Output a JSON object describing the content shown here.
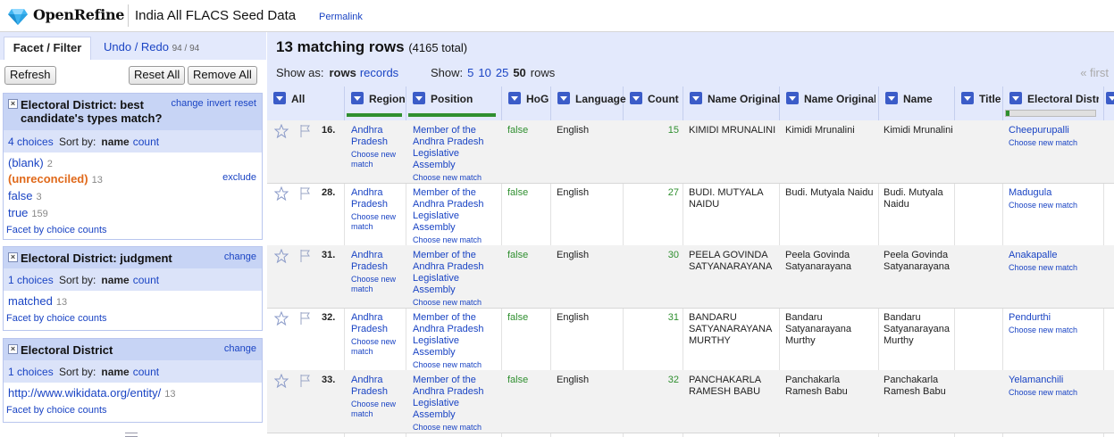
{
  "header": {
    "app_name": "OpenRefine",
    "project_name": "India All FLACS Seed Data",
    "permalink": "Permalink"
  },
  "left_panel": {
    "tabs": [
      {
        "label": "Facet / Filter"
      },
      {
        "label": "Undo / Redo",
        "count": "94 / 94"
      }
    ],
    "buttons": {
      "refresh": "Refresh",
      "reset_all": "Reset All",
      "remove_all": "Remove All"
    },
    "facets": [
      {
        "title_line1": "Electoral District: best",
        "title_line2": "candidate's types match?",
        "actions": [
          "change",
          "invert",
          "reset"
        ],
        "choices_count": "4 choices",
        "sort_by": "Sort by:",
        "sort_name": "name",
        "sort_count": "count",
        "choices": [
          {
            "label": "(blank)",
            "count": "2"
          },
          {
            "label": "(unreconciled)",
            "count": "13"
          },
          {
            "label": "false",
            "count": "3"
          },
          {
            "label": "true",
            "count": "159"
          }
        ],
        "exclude": "exclude",
        "facet_by_counts": "Facet by choice counts"
      },
      {
        "title_line1": "Electoral District: judgment",
        "actions": [
          "change"
        ],
        "choices_count": "1 choices",
        "sort_by": "Sort by:",
        "sort_name": "name",
        "sort_count": "count",
        "choices": [
          {
            "label": "matched",
            "count": "13"
          }
        ],
        "facet_by_counts": "Facet by choice counts"
      },
      {
        "title_line1": "Electoral District",
        "actions": [
          "change"
        ],
        "choices_count": "1 choices",
        "sort_by": "Sort by:",
        "sort_name": "name",
        "sort_count": "count",
        "choices": [
          {
            "label": "http://www.wikidata.org/entity/",
            "count": "13"
          }
        ],
        "facet_by_counts": "Facet by choice counts"
      }
    ]
  },
  "grid": {
    "matching": "13 matching rows",
    "total": "(4165 total)",
    "show_as_label": "Show as:",
    "show_as_rows": "rows",
    "show_as_records": "records",
    "show_label": "Show:",
    "page_sizes": [
      "5",
      "10",
      "25"
    ],
    "page_size_selected": "50",
    "rows_word": "rows",
    "first": "« first",
    "columns": [
      "All",
      "Region",
      "Position",
      "HoG",
      "Language",
      "Count",
      "Name Original",
      "Name Original T",
      "Name",
      "Title",
      "Electoral Distric"
    ],
    "choose_new_match": "Choose new match",
    "rows": [
      {
        "n": "16.",
        "region": "Andhra Pradesh",
        "position": "Member of the Andhra Pradesh Legislative Assembly",
        "hog": "false",
        "lang": "English",
        "count": "15",
        "name_orig": "KIMIDI MRUNALINI",
        "name_orig_t": "Kimidi Mrunalini",
        "name": "Kimidi Mrunalini",
        "title": "",
        "district": "Cheepurupalli"
      },
      {
        "n": "28.",
        "region": "Andhra Pradesh",
        "position": "Member of the Andhra Pradesh Legislative Assembly",
        "hog": "false",
        "lang": "English",
        "count": "27",
        "name_orig": "BUDI. MUTYALA NAIDU",
        "name_orig_t": "Budi. Mutyala Naidu",
        "name": "Budi. Mutyala Naidu",
        "title": "",
        "district": "Madugula"
      },
      {
        "n": "31.",
        "region": "Andhra Pradesh",
        "position": "Member of the Andhra Pradesh Legislative Assembly",
        "hog": "false",
        "lang": "English",
        "count": "30",
        "name_orig": "PEELA GOVINDA SATYANARAYANA",
        "name_orig_t": "Peela Govinda Satyanarayana",
        "name": "Peela Govinda Satyanarayana",
        "title": "",
        "district": "Anakapalle"
      },
      {
        "n": "32.",
        "region": "Andhra Pradesh",
        "position": "Member of the Andhra Pradesh Legislative Assembly",
        "hog": "false",
        "lang": "English",
        "count": "31",
        "name_orig": "BANDARU SATYANARAYANA MURTHY",
        "name_orig_t": "Bandaru Satyanarayana Murthy",
        "name": "Bandaru Satyanarayana Murthy",
        "title": "",
        "district": "Pendurthi"
      },
      {
        "n": "33.",
        "region": "Andhra Pradesh",
        "position": "Member of the Andhra Pradesh Legislative Assembly",
        "hog": "false",
        "lang": "English",
        "count": "32",
        "name_orig": "PANCHAKARLA RAMESH BABU",
        "name_orig_t": "Panchakarla Ramesh Babu",
        "name": "Panchakarla Ramesh Babu",
        "title": "",
        "district": "Yelamanchili"
      }
    ]
  }
}
